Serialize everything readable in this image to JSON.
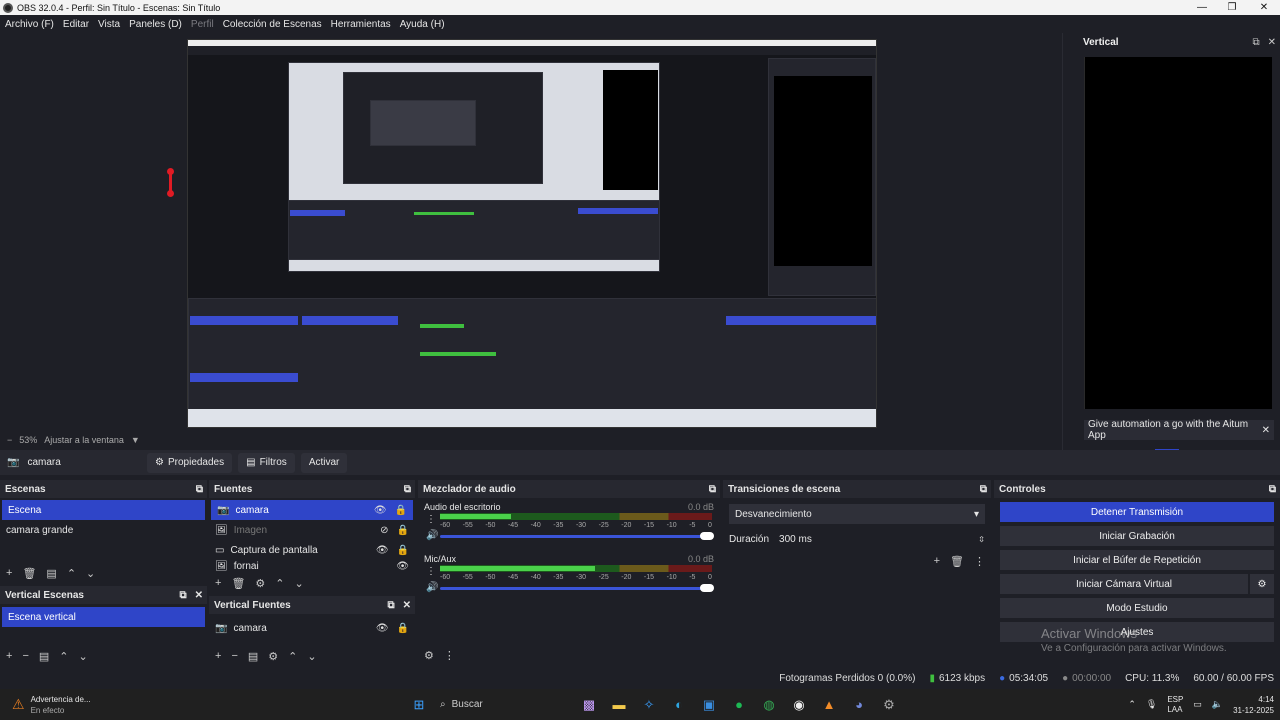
{
  "window": {
    "title": "OBS 32.0.4 - Perfil: Sin Título - Escenas: Sin Título"
  },
  "menu": [
    "Archivo (F)",
    "Editar",
    "Vista",
    "Paneles (D)",
    "Perfil",
    "Colección de Escenas",
    "Herramientas",
    "Ayuda (H)"
  ],
  "zoom": {
    "minus": "−",
    "level": "53%",
    "fit_label": "Ajustar a la ventana"
  },
  "vertical_dock": {
    "title": "Vertical",
    "note": "Give automation a go with the Aitum App"
  },
  "source_toolbar": {
    "source_name": "camara",
    "properties": "Propiedades",
    "filters": "Filtros",
    "activate": "Activar"
  },
  "scenes": {
    "title": "Escenas",
    "items": [
      "Escena",
      "camara grande"
    ]
  },
  "vertical_scenes": {
    "title": "Vertical Escenas",
    "items": [
      "Escena vertical"
    ]
  },
  "sources": {
    "title": "Fuentes",
    "items": [
      "camara",
      "Imagen",
      "Captura de pantalla",
      "fornai"
    ]
  },
  "vertical_sources": {
    "title": "Vertical Fuentes",
    "items": [
      "camara"
    ]
  },
  "mixer": {
    "title": "Mezclador de audio",
    "channels": [
      {
        "name": "Audio del escritorio",
        "db": "0.0 dB",
        "level": 0.26
      },
      {
        "name": "Mic/Aux",
        "db": "0.0 dB",
        "level": 0.57
      }
    ],
    "ticks": [
      "-60",
      "-55",
      "-50",
      "-45",
      "-40",
      "-35",
      "-30",
      "-25",
      "-20",
      "-15",
      "-10",
      "-5",
      "0"
    ]
  },
  "transitions": {
    "title": "Transiciones de escena",
    "selected": "Desvanecimiento",
    "duration_label": "Duración",
    "duration_value": "300 ms"
  },
  "controls": {
    "title": "Controles",
    "buttons": [
      "Detener Transmisión",
      "Iniciar Grabación",
      "Iniciar el Búfer de Repetición",
      "Iniciar Cámara Virtual",
      "Modo Estudio",
      "Ajustes"
    ]
  },
  "watermark": {
    "line1": "Activar Windows",
    "line2": "Ve a Configuración para activar Windows."
  },
  "status": {
    "dropped": "Fotogramas Perdidos 0 (0.0%)",
    "bitrate": "6123 kbps",
    "time_live": "05:34:05",
    "time_rec": "00:00:00",
    "cpu": "CPU: 11.3%",
    "fps": "60.00 / 60.00 FPS"
  },
  "taskbar": {
    "warning_title": "Advertencia de...",
    "warning_sub": "En efecto",
    "search": "Buscar",
    "lang1": "ESP",
    "lang2": "LAA",
    "time": "4:14",
    "date": "31-12-2025"
  },
  "colors": {
    "accent": "#2f45c8",
    "meter_green": "#4ad14a",
    "bg": "#1e1f26",
    "live_green": "#3fbf3f"
  }
}
